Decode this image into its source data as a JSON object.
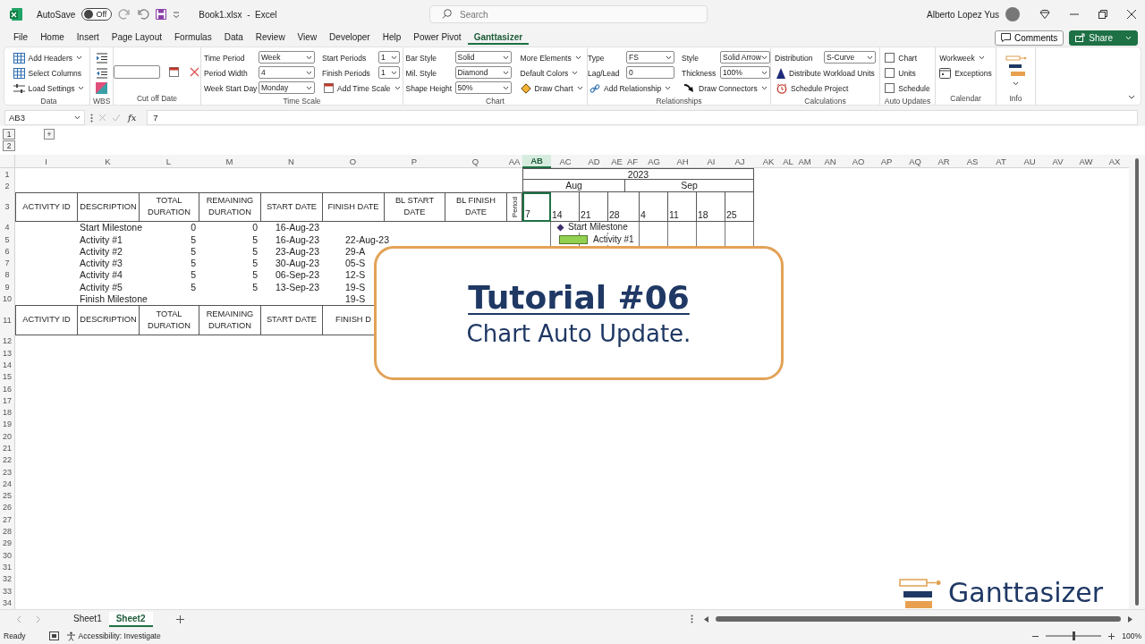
{
  "title_bar": {
    "autosave_label": "AutoSave",
    "autosave": {
      "on": false,
      "label": "Off"
    },
    "document_title": "Book1.xlsx  -  Excel",
    "search": {
      "placeholder": "Search"
    },
    "user_name": "Alberto Lopez Yus"
  },
  "menu_tabs": [
    {
      "label": "File",
      "selected": false
    },
    {
      "label": "Home",
      "selected": false
    },
    {
      "label": "Insert",
      "selected": false
    },
    {
      "label": "Page Layout",
      "selected": false
    },
    {
      "label": "Formulas",
      "selected": false
    },
    {
      "label": "Data",
      "selected": false
    },
    {
      "label": "Review",
      "selected": false
    },
    {
      "label": "View",
      "selected": false
    },
    {
      "label": "Developer",
      "selected": false
    },
    {
      "label": "Help",
      "selected": false
    },
    {
      "label": "Power Pivot",
      "selected": false
    },
    {
      "label": "Ganttasizer",
      "selected": true
    }
  ],
  "header_buttons": [
    {
      "kind": "comments",
      "label": "Comments"
    },
    {
      "kind": "share",
      "label": "Share"
    }
  ],
  "ribbon_groups": [
    {
      "label": "Data",
      "columns": [
        [
          {
            "kind": "button",
            "label": "Add Headers",
            "dropdown": true
          },
          {
            "kind": "button",
            "label": "Select Columns",
            "dropdown": false
          },
          {
            "kind": "button",
            "label": "Load Settings",
            "dropdown": true
          }
        ]
      ]
    },
    {
      "label": "WBS",
      "columns": [
        [
          {
            "kind": "icon"
          },
          {
            "kind": "icon"
          },
          {
            "kind": "icon"
          }
        ]
      ]
    },
    {
      "label": "Cut off Date",
      "columns": [
        [
          {
            "kind": "input"
          }
        ],
        [
          {
            "kind": "icon"
          }
        ],
        [
          {
            "kind": "icon"
          }
        ]
      ]
    },
    {
      "label": "Time Scale",
      "columns": [
        [
          {
            "kind": "select",
            "label": "Time Period",
            "value": "Week"
          },
          {
            "kind": "select",
            "label": "Period Width",
            "value": "4"
          },
          {
            "kind": "select",
            "label": "Week Start Day",
            "value": "Monday"
          }
        ],
        [
          {
            "kind": "select",
            "label": "Start Periods",
            "value": "1"
          },
          {
            "kind": "select",
            "label": "Finish Periods",
            "value": "1"
          },
          {
            "kind": "button",
            "label": "Add Time Scale",
            "dropdown": true
          }
        ]
      ]
    },
    {
      "label": "Chart",
      "columns": [
        [
          {
            "kind": "select",
            "label": "Bar Style",
            "value": "Solid"
          },
          {
            "kind": "select",
            "label": "Mil. Style",
            "value": "Diamond"
          },
          {
            "kind": "select",
            "label": "Shape Height",
            "value": "50%"
          }
        ],
        [
          {
            "kind": "menu",
            "label": "More Elements",
            "dropdown": true
          },
          {
            "kind": "menu",
            "label": "Default Colors",
            "dropdown": true
          },
          {
            "kind": "button",
            "label": "Draw Chart",
            "dropdown": true
          }
        ]
      ]
    },
    {
      "label": "Relationships",
      "columns": [
        [
          {
            "kind": "select",
            "label": "Type",
            "value": "FS"
          },
          {
            "kind": "input",
            "label": "Lag/Lead",
            "value": "0"
          },
          {
            "kind": "button",
            "label": "Add Relationship",
            "dropdown": true
          }
        ],
        [
          {
            "kind": "select",
            "label": "Style",
            "value": "Solid Arrow"
          },
          {
            "kind": "select",
            "label": "Thickness",
            "value": "100%"
          },
          {
            "kind": "button",
            "label": "Draw Connectors",
            "dropdown": true
          }
        ]
      ]
    },
    {
      "label": "Calculations",
      "columns": [
        [
          {
            "kind": "select",
            "label": "Distribution",
            "value": "S-Curve"
          },
          {
            "kind": "button",
            "label": "Distribute Workload Units",
            "dropdown": false
          },
          {
            "kind": "button",
            "label": "Schedule Project",
            "dropdown": false
          }
        ]
      ]
    },
    {
      "label": "Auto Updates",
      "columns": [
        [
          {
            "kind": "checkbox",
            "label": "Chart",
            "checked": false
          },
          {
            "kind": "checkbox",
            "label": "Units",
            "checked": false
          },
          {
            "kind": "checkbox",
            "label": "Schedule",
            "checked": false
          }
        ]
      ]
    },
    {
      "label": "Calendar",
      "columns": [
        [
          {
            "kind": "menu",
            "label": "Workweek",
            "dropdown": true
          },
          {
            "kind": "button",
            "label": "Exceptions",
            "dropdown": false
          }
        ]
      ]
    },
    {
      "label": "Info",
      "columns": [
        [
          {
            "kind": "large",
            "dropdown": true
          }
        ]
      ]
    }
  ],
  "formula_bar": {
    "name_box": "AB3",
    "function_label": "fx",
    "value": "7"
  },
  "outline": {
    "levels": [
      "1",
      "2"
    ],
    "expand": "+"
  },
  "sheet": {
    "columns": [
      {
        "label": "I",
        "selected": false
      },
      {
        "label": "K",
        "selected": false
      },
      {
        "label": "L",
        "selected": false
      },
      {
        "label": "M",
        "selected": false
      },
      {
        "label": "N",
        "selected": false
      },
      {
        "label": "O",
        "selected": false
      },
      {
        "label": "P",
        "selected": false
      },
      {
        "label": "Q",
        "selected": false
      },
      {
        "label": "AA",
        "selected": false
      },
      {
        "label": "AB",
        "selected": true
      },
      {
        "label": "AC",
        "selected": false
      },
      {
        "label": "AD",
        "selected": false
      },
      {
        "label": "AE",
        "selected": false
      },
      {
        "label": "AF",
        "selected": false
      },
      {
        "label": "AG",
        "selected": false
      },
      {
        "label": "AH",
        "selected": false
      },
      {
        "label": "AI",
        "selected": false
      },
      {
        "label": "AJ",
        "selected": false
      },
      {
        "label": "AK",
        "selected": false
      },
      {
        "label": "AL",
        "selected": false
      },
      {
        "label": "AM",
        "selected": false
      },
      {
        "label": "AN",
        "selected": false
      },
      {
        "label": "AO",
        "selected": false
      },
      {
        "label": "AP",
        "selected": false
      },
      {
        "label": "AQ",
        "selected": false
      },
      {
        "label": "AR",
        "selected": false
      },
      {
        "label": "AS",
        "selected": false
      },
      {
        "label": "AT",
        "selected": false
      },
      {
        "label": "AU",
        "selected": false
      },
      {
        "label": "AV",
        "selected": false
      },
      {
        "label": "AW",
        "selected": false
      },
      {
        "label": "AX",
        "selected": false
      }
    ],
    "row_numbers": [
      "1",
      "2",
      "3",
      "4",
      "5",
      "6",
      "7",
      "8",
      "9",
      "10",
      "11",
      "12",
      "13",
      "14",
      "15",
      "16",
      "17",
      "18",
      "19",
      "20",
      "21",
      "22",
      "23",
      "24",
      "25",
      "26",
      "27",
      "28",
      "29",
      "30",
      "31",
      "32",
      "33",
      "34"
    ],
    "table_headers": [
      {
        "kind": "text",
        "label": "ACTIVITY ID"
      },
      {
        "kind": "text",
        "label": "DESCRIPTION"
      },
      {
        "kind": "text",
        "label": "TOTAL DURATION"
      },
      {
        "kind": "text",
        "label": "REMAINING DURATION"
      },
      {
        "kind": "text",
        "label": "START DATE"
      },
      {
        "kind": "text",
        "label": "FINISH DATE"
      },
      {
        "kind": "text",
        "label": "BL START DATE"
      },
      {
        "kind": "text",
        "label": "BL FINISH DATE"
      },
      {
        "kind": "vertical",
        "label": "Period"
      }
    ],
    "rows": [
      {
        "description": "Start Milestone",
        "total_duration": "0",
        "remaining_duration": "0",
        "start_date": "16-Aug-23",
        "gantt": {
          "kind": "milestone",
          "label": "Start Milestone"
        }
      },
      {
        "description": "Activity #1",
        "total_duration": "5",
        "remaining_duration": "5",
        "start_date": "16-Aug-23",
        "finish_date": "22-Aug-23",
        "gantt": {
          "kind": "bar",
          "label": "Activity #1"
        }
      },
      {
        "description": "Activity #2",
        "total_duration": "5",
        "remaining_duration": "5",
        "start_date": "23-Aug-23",
        "finish_date": "29-A"
      },
      {
        "description": "Activity #3",
        "total_duration": "5",
        "remaining_duration": "5",
        "start_date": "30-Aug-23",
        "finish_date": "05-S"
      },
      {
        "description": "Activity #4",
        "total_duration": "5",
        "remaining_duration": "5",
        "start_date": "06-Sep-23",
        "finish_date": "12-S"
      },
      {
        "description": "Activity #5",
        "total_duration": "5",
        "remaining_duration": "5",
        "start_date": "13-Sep-23",
        "finish_date": "19-S"
      },
      {
        "description": "Finish Milestone",
        "finish_date": "19-S"
      }
    ],
    "footer_headers": [
      "ACTIVITY ID",
      "DESCRIPTION",
      "TOTAL DURATION",
      "REMAINING DURATION",
      "START DATE",
      "FINISH D"
    ],
    "timeline": {
      "year": "2023",
      "months": [
        "Aug",
        "Sep"
      ],
      "weeks": [
        {
          "label": "7",
          "selected": true
        },
        {
          "label": "14",
          "selected": false
        },
        {
          "label": "21",
          "selected": false
        },
        {
          "label": "28",
          "selected": false
        },
        {
          "label": "4",
          "selected": false
        },
        {
          "label": "11",
          "selected": false
        },
        {
          "label": "18",
          "selected": false
        },
        {
          "label": "25",
          "selected": false
        }
      ]
    }
  },
  "sheet_tabs": [
    {
      "label": "Sheet1",
      "selected": false
    },
    {
      "label": "Sheet2",
      "selected": true
    }
  ],
  "status_bar": {
    "mode": "Ready",
    "accessibility": "Accessibility: Investigate",
    "zoom_slider": {
      "level": 0.5
    },
    "zoom": "100%"
  },
  "overlay_card": {
    "title": "Tutorial #06",
    "subtitle": "Chart Auto Update."
  },
  "brand_logo": {
    "text": "Ganttasizer"
  }
}
